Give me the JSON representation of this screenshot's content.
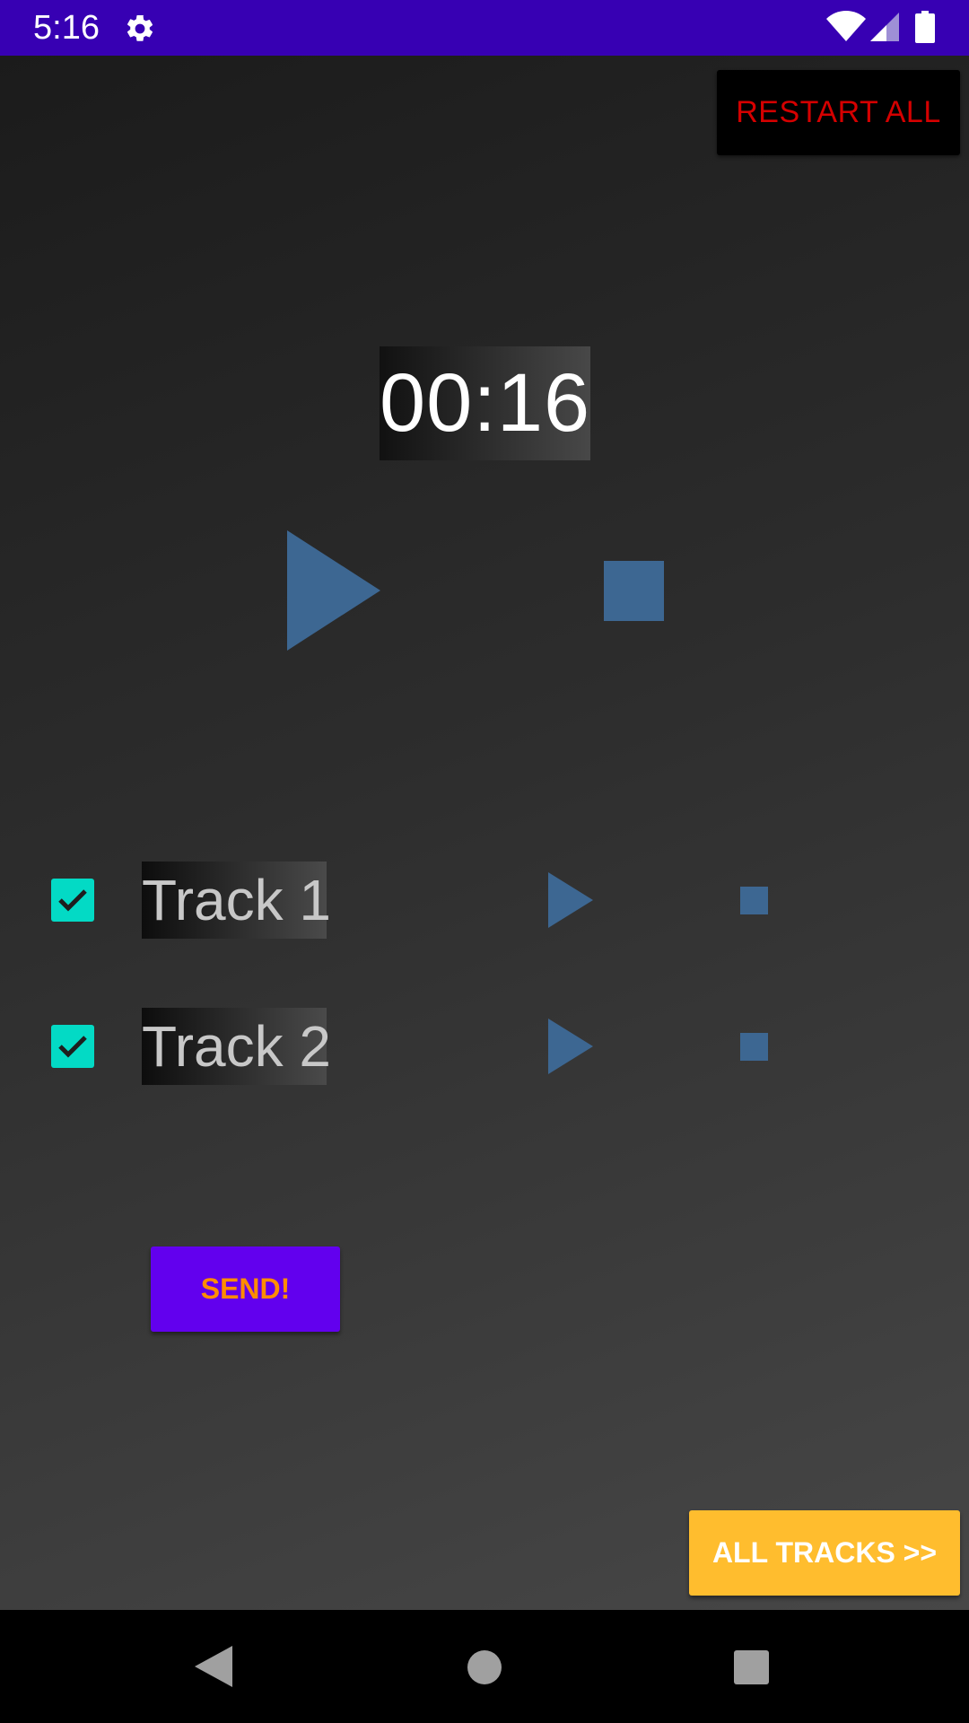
{
  "status_bar": {
    "time": "5:16",
    "icons": [
      "gear-icon",
      "wifi-icon",
      "cell-signal-icon",
      "battery-icon"
    ],
    "background_color": "#3700b3"
  },
  "app": {
    "restart_all_label": "RESTART ALL",
    "timer": "00:16",
    "main_controls": {
      "play_icon": "play-icon",
      "stop_icon": "stop-icon"
    },
    "tracks": [
      {
        "label": "Track 1",
        "checked": true
      },
      {
        "label": "Track 2",
        "checked": true
      }
    ],
    "send_label": "SEND!",
    "all_tracks_label": "ALL TRACKS >>"
  },
  "nav_bar": {
    "icons": [
      "back-icon",
      "home-icon",
      "recents-icon"
    ]
  },
  "colors": {
    "accent_blue": "#3d6792",
    "checkbox_teal": "#03dac5",
    "send_purple": "#6200ee",
    "send_text_orange": "#ff8c00",
    "all_tracks_amber": "#ffbd2e",
    "restart_text_red": "#d50000"
  }
}
